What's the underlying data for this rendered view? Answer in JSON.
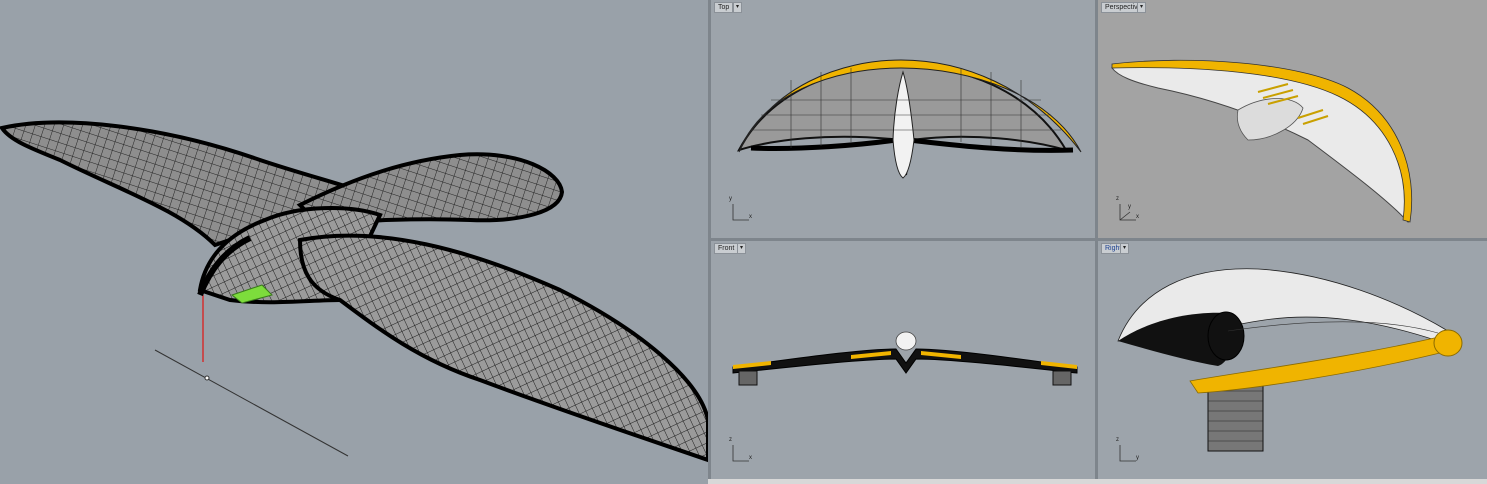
{
  "viewports": {
    "top": {
      "label": "Top",
      "axis_x": "x",
      "axis_y": "y"
    },
    "perspective": {
      "label": "Perspective",
      "axis_x": "x",
      "axis_y": "y",
      "axis_z": "z"
    },
    "front": {
      "label": "Front",
      "axis_x": "x",
      "axis_z": "z"
    },
    "right": {
      "label": "Right",
      "axis_y": "y",
      "axis_z": "z"
    }
  },
  "colors": {
    "viewport_bg": "#9da4ab",
    "wing_accent": "#f0b400",
    "mesh_line": "#111111",
    "highlight": "#7ddc3c"
  },
  "icons": {
    "dropdown": "chevron-down-icon"
  }
}
